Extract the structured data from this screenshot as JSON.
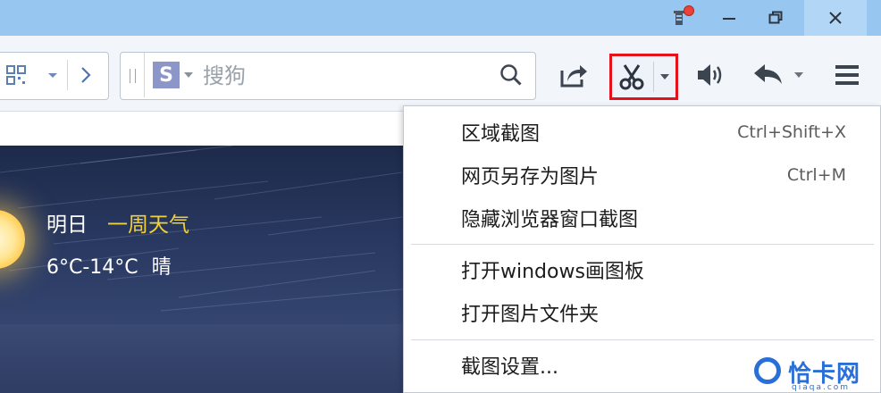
{
  "titlebar": {
    "buttons": [
      "minimize",
      "restore",
      "close"
    ],
    "colors": {
      "bar": "#97c7f1",
      "close_bg": "#b2d6f6"
    }
  },
  "toolbar": {
    "search": {
      "engine": "S",
      "placeholder": "搜狗"
    },
    "tools": [
      "share-icon",
      "scissors-icon",
      "speaker-icon",
      "undo-icon",
      "menu-icon"
    ],
    "highlight_color": "#e5121b"
  },
  "weather": {
    "day_label": "明日",
    "week_link": "一周天气",
    "temperature": "6°C-14°C",
    "condition": "晴"
  },
  "menu": {
    "items": [
      {
        "label": "区域截图",
        "shortcut": "Ctrl+Shift+X"
      },
      {
        "label": "网页另存为图片",
        "shortcut": "Ctrl+M"
      },
      {
        "label": "隐藏浏览器窗口截图",
        "shortcut": ""
      },
      {
        "label": "打开windows画图板",
        "shortcut": ""
      },
      {
        "label": "打开图片文件夹",
        "shortcut": ""
      },
      {
        "label": "截图设置...",
        "shortcut": ""
      }
    ]
  },
  "watermark": {
    "name": "恰卡网",
    "domain": "qiaqa.com"
  }
}
